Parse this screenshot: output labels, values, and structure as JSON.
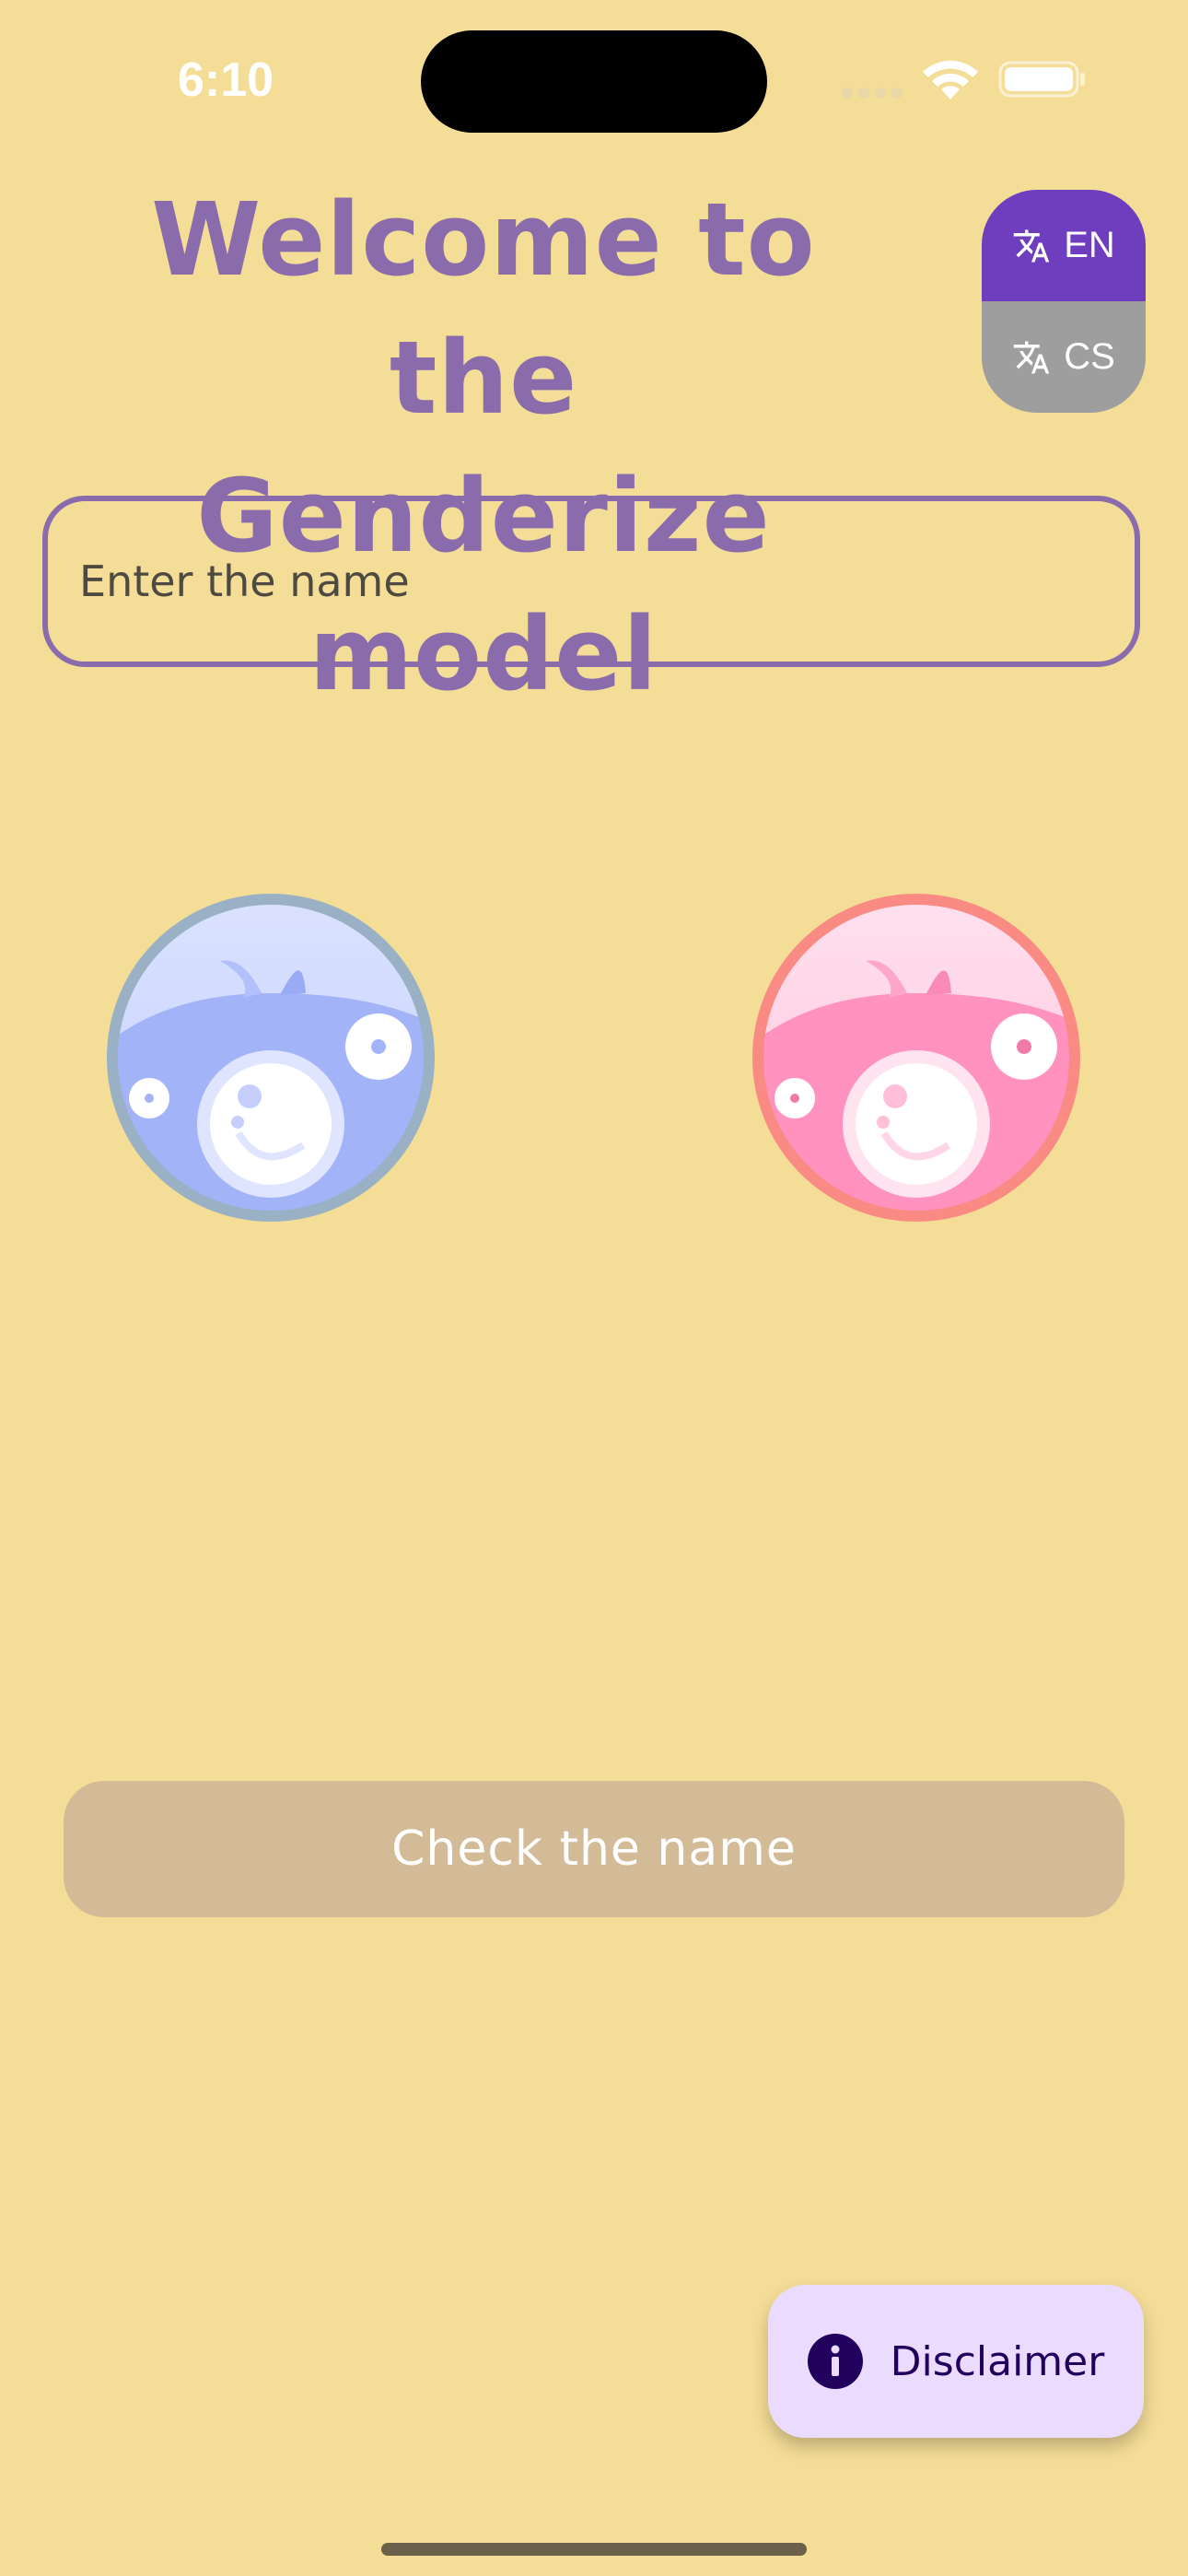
{
  "status_bar": {
    "time": "6:10"
  },
  "header": {
    "title": "Welcome to the\nGenderize model"
  },
  "language": {
    "options": [
      {
        "code": "EN",
        "selected": true
      },
      {
        "code": "CS",
        "selected": false
      }
    ]
  },
  "form": {
    "name_placeholder": "Enter the name",
    "name_value": ""
  },
  "avatars": {
    "male_icon": "male-avatar-icon",
    "female_icon": "female-avatar-icon"
  },
  "actions": {
    "check_label": "Check the name"
  },
  "fab": {
    "disclaimer_label": "Disclaimer",
    "icon": "info-icon"
  },
  "colors": {
    "background": "#f4dd97",
    "title": "#8a6cad",
    "lang_selected": "#6e3ebf",
    "lang_unselected": "#9e9e9e",
    "check_button": "#d4bb98",
    "fab_background": "#eadbff"
  }
}
